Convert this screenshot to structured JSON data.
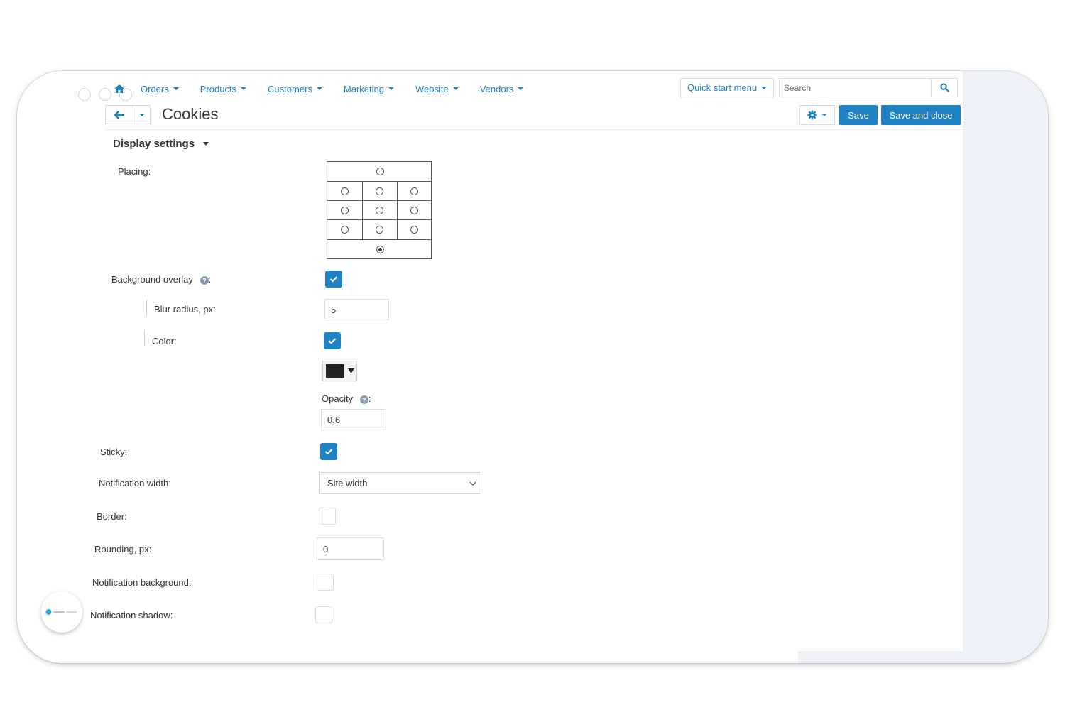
{
  "nav": {
    "items": [
      "Orders",
      "Products",
      "Customers",
      "Marketing",
      "Website",
      "Vendors"
    ],
    "quick_start": "Quick start menu",
    "search_placeholder": "Search"
  },
  "header": {
    "title": "Cookies",
    "save_label": "Save",
    "save_close_label": "Save and close"
  },
  "section": {
    "title": "Display settings"
  },
  "fields": {
    "placing": {
      "label": "Placing:",
      "selected": "bottom"
    },
    "background_overlay": {
      "label": "Background overlay",
      "checked": true
    },
    "blur_radius": {
      "label": "Blur radius, px:",
      "value": "5"
    },
    "color": {
      "label": "Color:",
      "checked": true,
      "swatch": "#222222"
    },
    "opacity": {
      "label": "Opacity",
      "value": "0,6"
    },
    "sticky": {
      "label": "Sticky:",
      "checked": true
    },
    "notification_width": {
      "label": "Notification width:",
      "value": "Site width"
    },
    "border": {
      "label": "Border:",
      "checked": false
    },
    "rounding": {
      "label": "Rounding, px:",
      "value": "0"
    },
    "notification_background": {
      "label": "Notification background:",
      "checked": false
    },
    "notification_shadow": {
      "label": "Notification shadow:",
      "checked": false
    }
  },
  "colors": {
    "accent": "#1e82c4",
    "side_background": "#eef1f8"
  }
}
